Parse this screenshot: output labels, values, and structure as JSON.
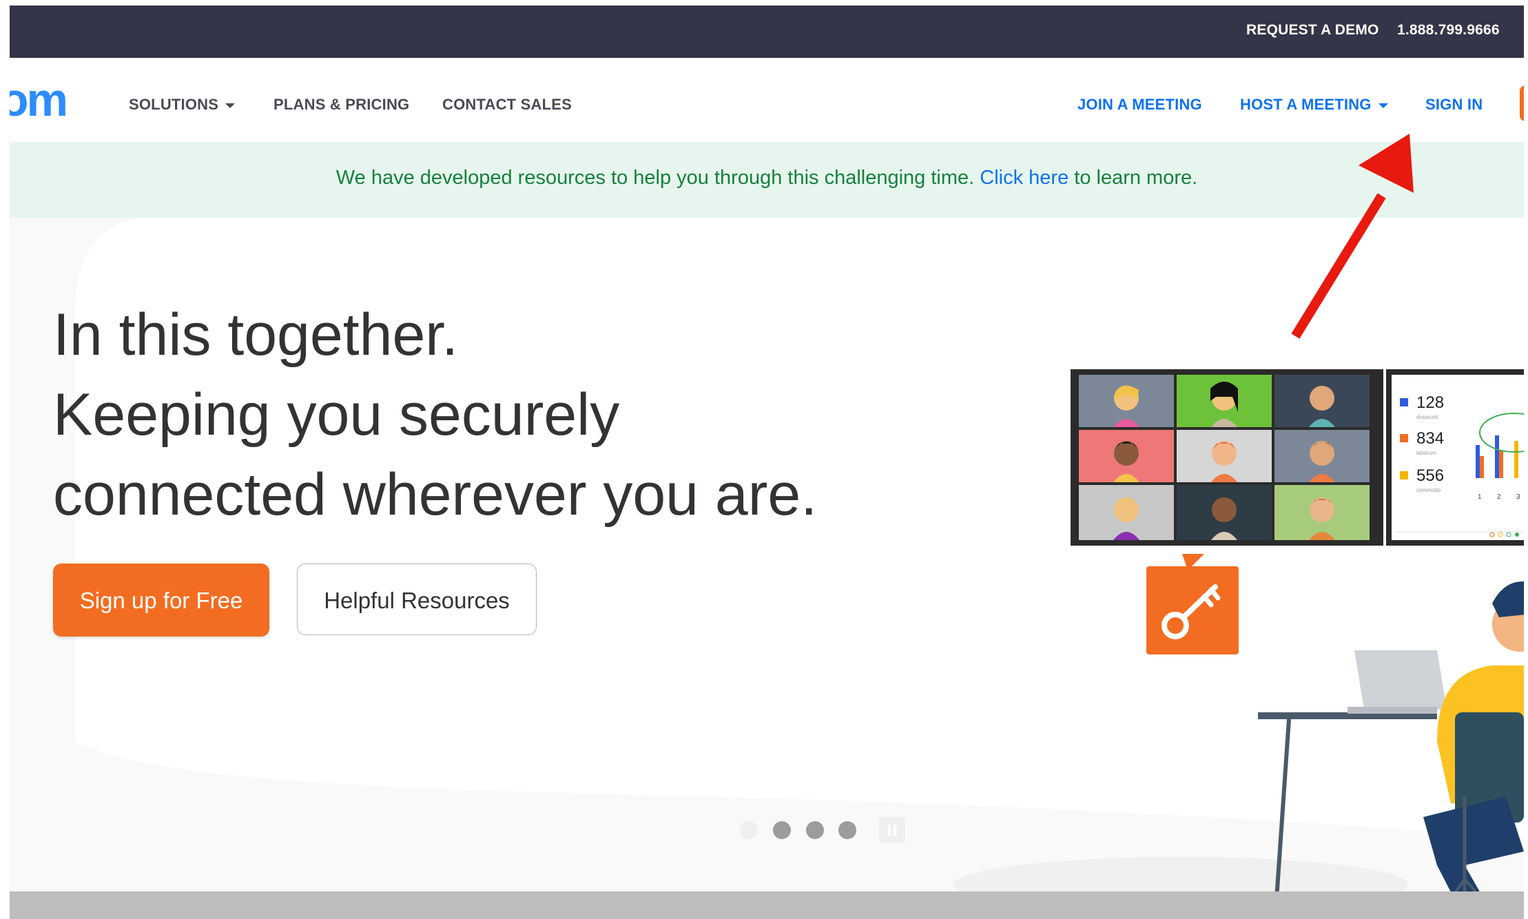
{
  "topbar": {
    "request_demo": "REQUEST A DEMO",
    "phone": "1.888.799.9666"
  },
  "nav": {
    "logo_text": "om",
    "solutions": "SOLUTIONS",
    "plans_pricing": "PLANS & PRICING",
    "contact_sales": "CONTACT SALES",
    "join_meeting": "JOIN A MEETING",
    "host_meeting": "HOST A MEETING",
    "sign_in": "SIGN IN"
  },
  "banner": {
    "text_before": "We have developed resources to help you through this challenging time. ",
    "link_text": "Click here",
    "text_after": " to learn more."
  },
  "hero": {
    "headline_line1": "In this together.",
    "headline_line2": "Keeping you securely",
    "headline_line3": "connected wherever you are.",
    "primary_button": "Sign up for Free",
    "secondary_button": "Helpful Resources"
  },
  "illustration": {
    "stat1": "128",
    "stat1_caption": "dosarunt",
    "stat2": "834",
    "stat2_caption": "labarum",
    "stat3": "556",
    "stat3_caption": "commodo",
    "axis_ticks": [
      "1",
      "2",
      "3"
    ]
  },
  "carousel": {
    "slide_count": 4,
    "active_index": 0
  },
  "colors": {
    "topbar": "#353549",
    "brand_blue": "#0e72ed",
    "brand_orange": "#f26d21",
    "banner_bg": "#e6f6ee",
    "banner_text": "#16803c",
    "annotation_red": "#e8190f"
  }
}
